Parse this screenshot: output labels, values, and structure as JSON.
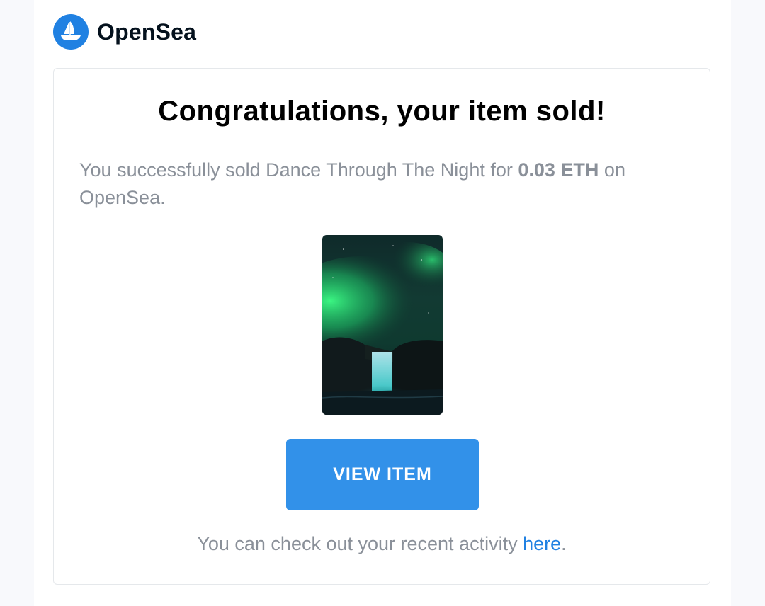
{
  "brand": {
    "name": "OpenSea",
    "logo_icon": "opensea-boat-icon",
    "accent_color": "#2081e2"
  },
  "email": {
    "title": "Congratulations, your item sold!",
    "message_prefix": "You successfully sold Dance Through The Night for ",
    "amount": "0.03 ETH",
    "message_suffix": " on OpenSea.",
    "item_image_alt": "aurora-waterfall-image",
    "button_label": "VIEW ITEM",
    "button_color": "#3291e9",
    "footer_prefix": "You can check out your recent activity ",
    "footer_link": "here",
    "footer_suffix": "."
  }
}
